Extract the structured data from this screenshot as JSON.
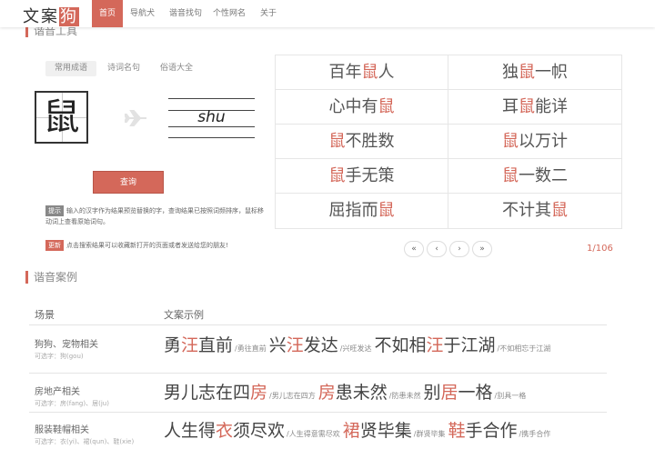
{
  "nav": {
    "logo_pre": "文案",
    "logo_hl": "狗",
    "items": [
      "首页",
      "导航犬",
      "谐音找句",
      "个性网名",
      "关于"
    ]
  },
  "tool": {
    "title": "谐音工具",
    "tabs": [
      "常用成语",
      "诗词名句",
      "俗语大全"
    ],
    "char": "鼠",
    "pinyin": "shu",
    "query": "查询",
    "tip_tag": "提示",
    "tip": "输入的汉字作为结果预览替换的字，查询结果已按照词频排序，鼠标移动词上查看原始词句。",
    "update_tag": "更新",
    "update": "点击搜索结果可以收藏新打开的页面或者发送给您的朋友!"
  },
  "results": [
    {
      "pre": "百年",
      "hl": "鼠",
      "post": "人"
    },
    {
      "pre": "独",
      "hl": "鼠",
      "post": "一帜"
    },
    {
      "pre": "心中有",
      "hl": "鼠",
      "post": ""
    },
    {
      "pre": "耳",
      "hl": "鼠",
      "post": "能详"
    },
    {
      "pre": "",
      "hl": "鼠",
      "post": "不胜数"
    },
    {
      "pre": "",
      "hl": "鼠",
      "post": "以万计"
    },
    {
      "pre": "",
      "hl": "鼠",
      "post": "手无策"
    },
    {
      "pre": "",
      "hl": "鼠",
      "post": "一数二"
    },
    {
      "pre": "屈指而",
      "hl": "鼠",
      "post": ""
    },
    {
      "pre": "不计其",
      "hl": "鼠",
      "post": ""
    }
  ],
  "pagination": {
    "first": "«",
    "prev": "‹",
    "next": "›",
    "last": "»",
    "info": "1/106"
  },
  "cases": {
    "title": "谐音案例",
    "col1": "场景",
    "col2": "文案示例",
    "rows": [
      {
        "scene": "狗狗、宠物相关",
        "chars": "可选字：狗(gou)",
        "ex": [
          {
            "pre": "勇",
            "hl": "汪",
            "post": "直前",
            "orig": "/勇往直前"
          },
          {
            "pre": "兴",
            "hl": "汪",
            "post": "发达",
            "orig": "/兴旺发达"
          },
          {
            "pre": "不如相",
            "hl": "汪",
            "post": "于江湖",
            "orig": "/不如相忘于江湖"
          }
        ]
      },
      {
        "scene": "房地产相关",
        "chars": "可选字：房(fang)、居(ju)",
        "ex": [
          {
            "pre": "男儿志在四",
            "hl": "房",
            "post": "",
            "orig": "/男儿志在四方"
          },
          {
            "pre": "",
            "hl": "房",
            "post": "患未然",
            "orig": "/防患未然"
          },
          {
            "pre": "别",
            "hl": "居",
            "post": "一格",
            "orig": "/别具一格"
          }
        ]
      },
      {
        "scene": "服装鞋帽相关",
        "chars": "可选字：衣(yi)、裙(qun)、鞋(xie)",
        "ex": [
          {
            "pre": "人生得",
            "hl": "衣",
            "post": "须尽欢",
            "orig": "/人生得意需尽欢"
          },
          {
            "pre": "",
            "hl": "裙",
            "post": "贤毕集",
            "orig": "/群贤毕集"
          },
          {
            "pre": "",
            "hl": "鞋",
            "post": "手合作",
            "orig": "/携手合作"
          }
        ]
      }
    ]
  },
  "colors": {
    "accent": "#d4685a"
  }
}
